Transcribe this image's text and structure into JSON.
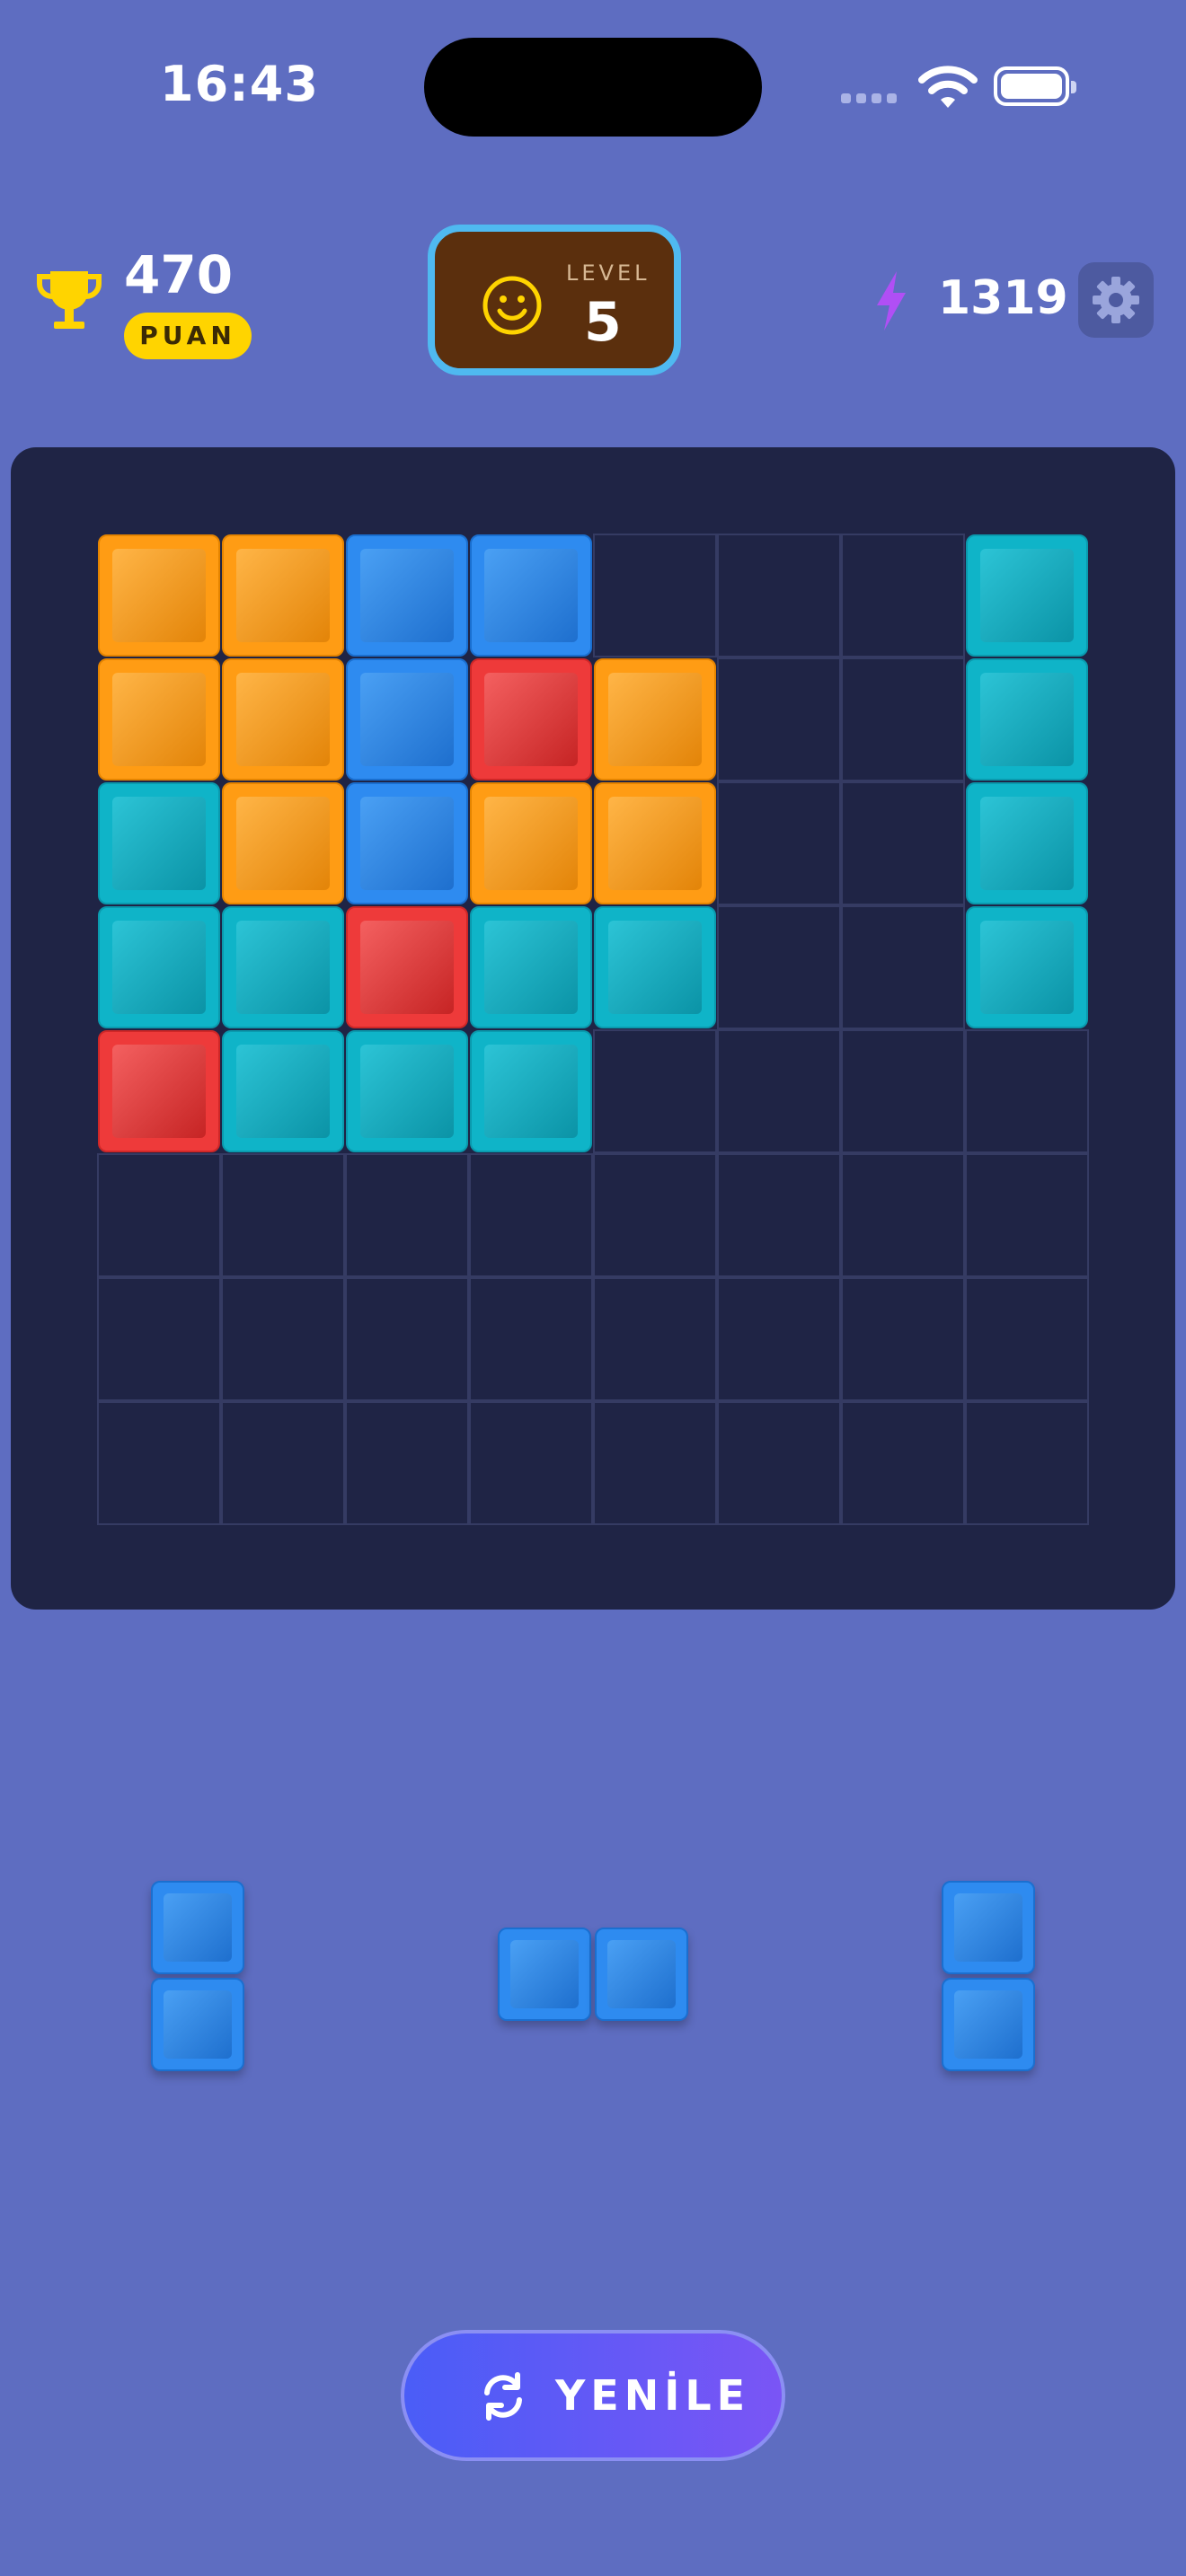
{
  "status_bar": {
    "time": "16:43"
  },
  "header": {
    "score": "470",
    "score_label": "PUAN",
    "level_label": "LEVEL",
    "level": "5",
    "energy": "1319"
  },
  "board": {
    "rows": [
      [
        "orange",
        "orange",
        "blue",
        "blue",
        "",
        "",
        "",
        "cyan"
      ],
      [
        "orange",
        "orange",
        "blue",
        "red",
        "orange",
        "",
        "",
        "cyan"
      ],
      [
        "cyan",
        "orange",
        "blue",
        "orange",
        "orange",
        "",
        "",
        "cyan"
      ],
      [
        "cyan",
        "cyan",
        "red",
        "cyan",
        "cyan",
        "",
        "",
        "cyan"
      ],
      [
        "red",
        "cyan",
        "cyan",
        "cyan",
        "",
        "",
        "",
        ""
      ],
      [
        "",
        "",
        "",
        "",
        "",
        "",
        "",
        ""
      ],
      [
        "",
        "",
        "",
        "",
        "",
        "",
        "",
        ""
      ],
      [
        "",
        "",
        "",
        "",
        "",
        "",
        "",
        ""
      ]
    ]
  },
  "pieces": [
    {
      "name": "piece-vertical-2-left",
      "color": "blue",
      "cells": [
        [
          0,
          0
        ],
        [
          1,
          0
        ]
      ]
    },
    {
      "name": "piece-horizontal-2",
      "color": "blue",
      "cells": [
        [
          0,
          0
        ],
        [
          0,
          1
        ]
      ]
    },
    {
      "name": "piece-vertical-2-right",
      "color": "blue",
      "cells": [
        [
          0,
          0
        ],
        [
          1,
          0
        ]
      ]
    }
  ],
  "actions": {
    "refresh_label": "YENİLE"
  },
  "colors": {
    "background": "#5e6dc1",
    "board": "#1f2445",
    "orange": "#ff9c14",
    "blue": "#2e8bf0",
    "cyan": "#0fb4c8",
    "red": "#ee3a3a",
    "badge": "#ffd400"
  },
  "icons": [
    "trophy-icon",
    "smiley-icon",
    "bolt-icon",
    "gear-icon",
    "refresh-icon",
    "wifi-icon",
    "battery-icon"
  ]
}
